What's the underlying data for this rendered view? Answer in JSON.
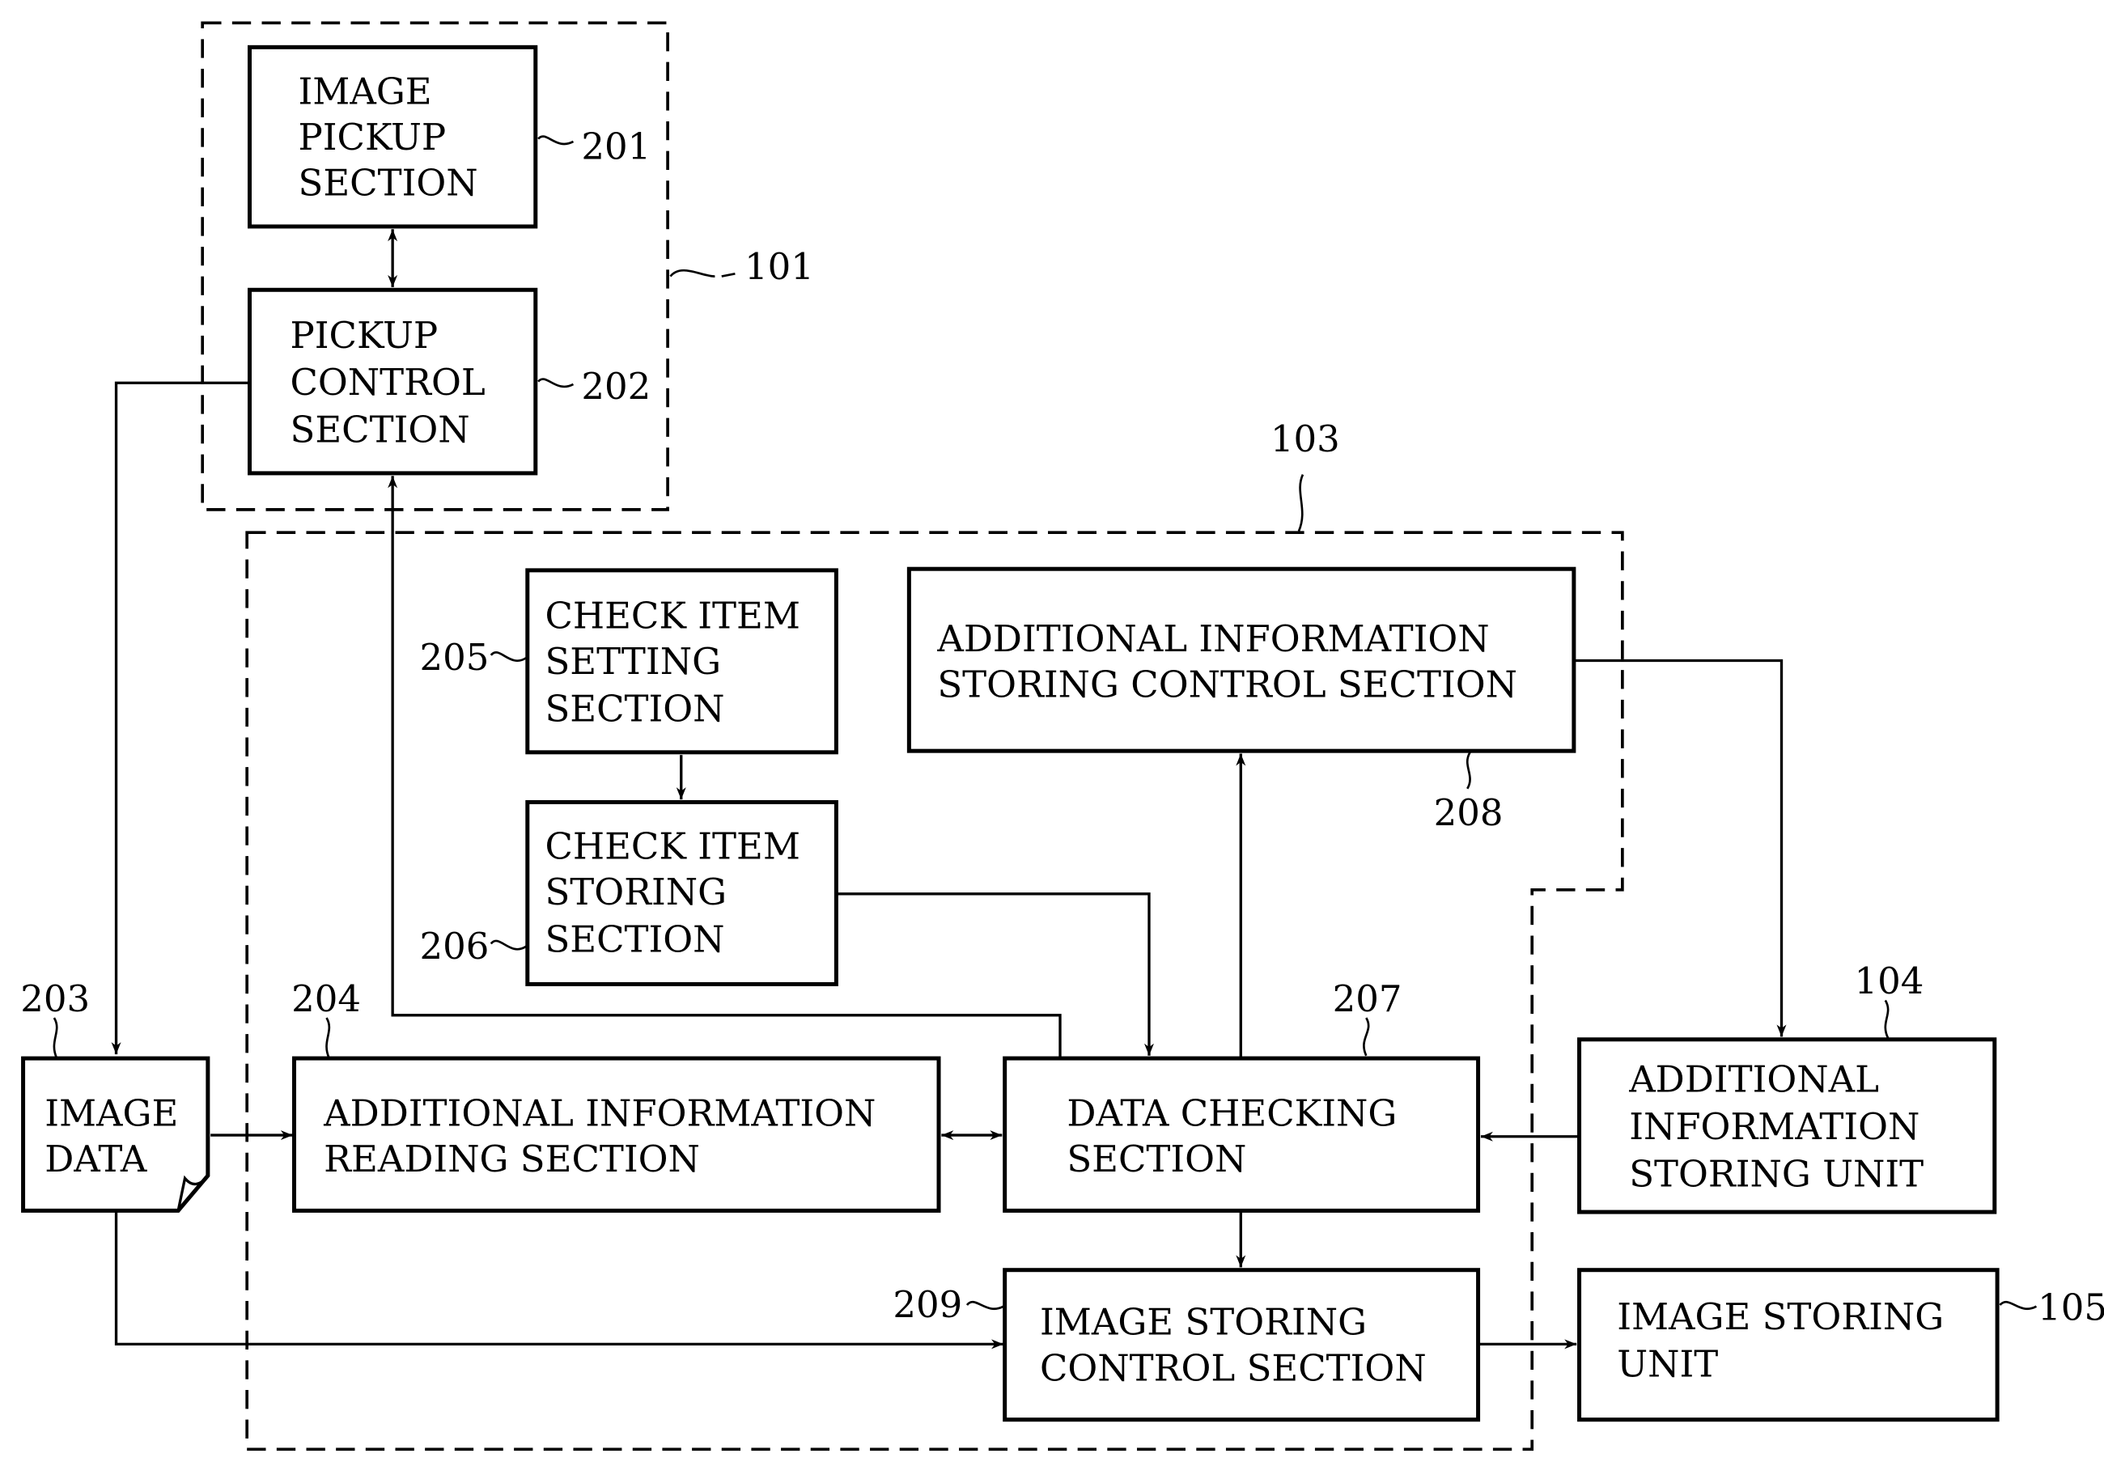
{
  "diagram": {
    "groups": {
      "g101": {
        "ref": "101"
      },
      "g103": {
        "ref": "103"
      }
    },
    "blocks": {
      "b201": {
        "ref": "201",
        "lines": [
          "IMAGE",
          "PICKUP",
          "SECTION"
        ]
      },
      "b202": {
        "ref": "202",
        "lines": [
          "PICKUP",
          "CONTROL",
          "SECTION"
        ]
      },
      "b203": {
        "ref": "203",
        "lines": [
          "IMAGE",
          "DATA"
        ]
      },
      "b204": {
        "ref": "204",
        "lines": [
          "ADDITIONAL INFORMATION",
          "READING SECTION"
        ]
      },
      "b205": {
        "ref": "205",
        "lines": [
          "CHECK ITEM",
          "SETTING",
          "SECTION"
        ]
      },
      "b206": {
        "ref": "206",
        "lines": [
          "CHECK ITEM",
          "STORING",
          "SECTION"
        ]
      },
      "b207": {
        "ref": "207",
        "lines": [
          "DATA CHECKING",
          "SECTION"
        ]
      },
      "b208": {
        "ref": "208",
        "lines": [
          "ADDITIONAL INFORMATION",
          "STORING CONTROL SECTION"
        ]
      },
      "b209": {
        "ref": "209",
        "lines": [
          "IMAGE STORING",
          "CONTROL SECTION"
        ]
      },
      "b104": {
        "ref": "104",
        "lines": [
          "ADDITIONAL",
          "INFORMATION",
          "STORING UNIT"
        ]
      },
      "b105": {
        "ref": "105",
        "lines": [
          "IMAGE STORING",
          "UNIT"
        ]
      }
    },
    "connections": [
      {
        "from": "201",
        "to": "202",
        "kind": "bidirectional"
      },
      {
        "from": "202",
        "to": "203",
        "kind": "arrow"
      },
      {
        "from": "207",
        "to": "202",
        "kind": "arrow"
      },
      {
        "from": "203",
        "to": "204",
        "kind": "arrow"
      },
      {
        "from": "203",
        "to": "209",
        "kind": "arrow"
      },
      {
        "from": "204",
        "to": "207",
        "kind": "bidirectional"
      },
      {
        "from": "205",
        "to": "206",
        "kind": "arrow"
      },
      {
        "from": "206",
        "to": "207",
        "kind": "arrow"
      },
      {
        "from": "207",
        "to": "208",
        "kind": "arrow"
      },
      {
        "from": "208",
        "to": "104",
        "kind": "arrow"
      },
      {
        "from": "104",
        "to": "207",
        "kind": "arrow"
      },
      {
        "from": "207",
        "to": "209",
        "kind": "arrow"
      },
      {
        "from": "209",
        "to": "105",
        "kind": "arrow"
      }
    ]
  }
}
